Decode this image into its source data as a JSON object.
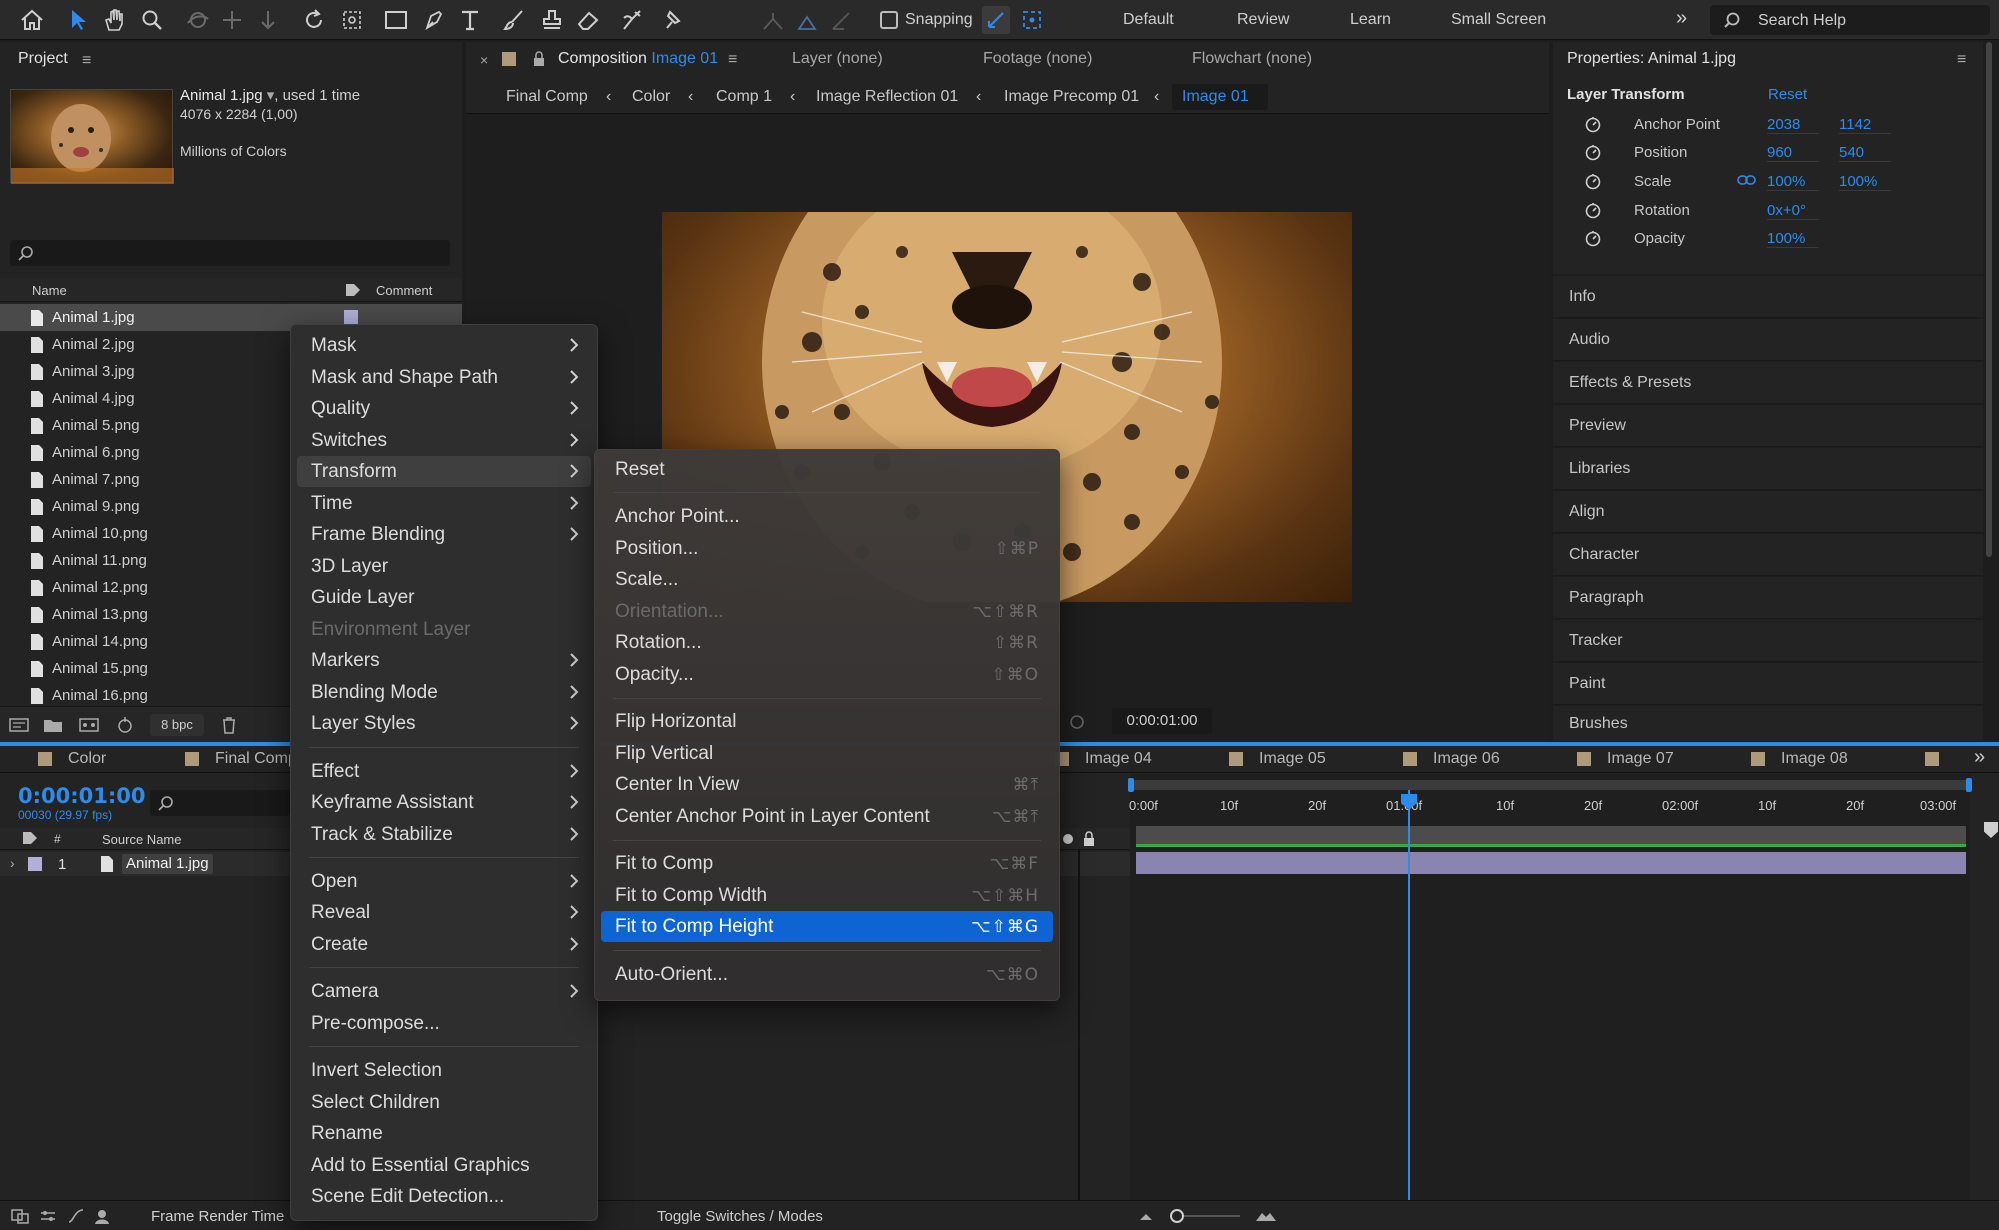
{
  "toolbar": {
    "snapping": "Snapping",
    "workspaces": [
      "Default",
      "Review",
      "Learn",
      "Small Screen"
    ],
    "search_placeholder": "Search Help"
  },
  "project": {
    "title": "Project",
    "file_name": "Animal 1.jpg",
    "used": ", used 1 time",
    "dimensions": "4076 x 2284 (1,00)",
    "colors": "Millions of Colors",
    "col_name": "Name",
    "col_comment": "Comment",
    "items": [
      "Animal 1.jpg",
      "Animal 2.jpg",
      "Animal 3.jpg",
      "Animal 4.jpg",
      "Animal 5.png",
      "Animal 6.png",
      "Animal 7.png",
      "Animal 9.png",
      "Animal 10.png",
      "Animal 11.png",
      "Animal 12.png",
      "Animal 13.png",
      "Animal 14.png",
      "Animal 15.png",
      "Animal 16.png"
    ],
    "bpc": "8 bpc"
  },
  "comp_tabs": {
    "composition_label": "Composition",
    "composition_name": "Image 01",
    "layer": "Layer (none)",
    "footage": "Footage (none)",
    "flowchart": "Flowchart (none)"
  },
  "breadcrumbs": [
    "Final Comp",
    "Color",
    "Comp 1",
    "Image Reflection 01",
    "Image Precomp 01",
    "Image 01"
  ],
  "viewer": {
    "timecode": "0:00:01:00"
  },
  "properties": {
    "title": "Properties: Animal 1.jpg",
    "section": "Layer Transform",
    "reset": "Reset",
    "rows": [
      {
        "label": "Anchor Point",
        "v1": "2038",
        "v2": "1142"
      },
      {
        "label": "Position",
        "v1": "960",
        "v2": "540"
      },
      {
        "label": "Scale",
        "v1": "100%",
        "v2": "100%"
      },
      {
        "label": "Rotation",
        "v1": "0x+0°",
        "v2": ""
      },
      {
        "label": "Opacity",
        "v1": "100%",
        "v2": ""
      }
    ]
  },
  "right_panels": [
    "Info",
    "Audio",
    "Effects & Presets",
    "Preview",
    "Libraries",
    "Align",
    "Character",
    "Paragraph",
    "Tracker",
    "Paint",
    "Brushes"
  ],
  "timeline": {
    "tabs_left": [
      "Color",
      "Final Comp"
    ],
    "tabs_right": [
      "Image 04",
      "Image 05",
      "Image 06",
      "Image 07",
      "Image 08"
    ],
    "timecode": "0:00:01:00",
    "fps": "00030 (29.97 fps)",
    "col_num": "#",
    "col_source": "Source Name",
    "layer_num": "1",
    "layer_name": "Animal 1.jpg",
    "ruler": [
      "0:00f",
      "10f",
      "20f",
      "01:00f",
      "10f",
      "20f",
      "02:00f",
      "10f",
      "20f",
      "03:00f"
    ],
    "bottom_left": "Frame Render Time",
    "toggle": "Toggle Switches / Modes"
  },
  "context_menu": [
    "Mask",
    "Mask and Shape Path",
    "Quality",
    "Switches",
    "Transform",
    "Time",
    "Frame Blending",
    "3D Layer",
    "Guide Layer",
    "Environment Layer",
    "Markers",
    "Blending Mode",
    "Layer Styles",
    "Effect",
    "Keyframe Assistant",
    "Track & Stabilize",
    "Open",
    "Reveal",
    "Create",
    "Camera",
    "Pre-compose...",
    "Invert Selection",
    "Select Children",
    "Rename",
    "Add to Essential Graphics",
    "Scene Edit Detection..."
  ],
  "transform_menu": [
    {
      "label": "Reset",
      "sc": ""
    },
    {
      "label": "Anchor Point...",
      "sc": ""
    },
    {
      "label": "Position...",
      "sc": "⇧⌘P"
    },
    {
      "label": "Scale...",
      "sc": ""
    },
    {
      "label": "Orientation...",
      "sc": "⌥⇧⌘R"
    },
    {
      "label": "Rotation...",
      "sc": "⇧⌘R"
    },
    {
      "label": "Opacity...",
      "sc": "⇧⌘O"
    },
    {
      "label": "Flip Horizontal",
      "sc": ""
    },
    {
      "label": "Flip Vertical",
      "sc": ""
    },
    {
      "label": "Center In View",
      "sc": "⌘⤒"
    },
    {
      "label": "Center Anchor Point in Layer Content",
      "sc": "⌥⌘⤒"
    },
    {
      "label": "Fit to Comp",
      "sc": "⌥⌘F"
    },
    {
      "label": "Fit to Comp Width",
      "sc": "⌥⇧⌘H"
    },
    {
      "label": "Fit to Comp Height",
      "sc": "⌥⇧⌘G"
    },
    {
      "label": "Auto-Orient...",
      "sc": "⌥⌘O"
    }
  ]
}
